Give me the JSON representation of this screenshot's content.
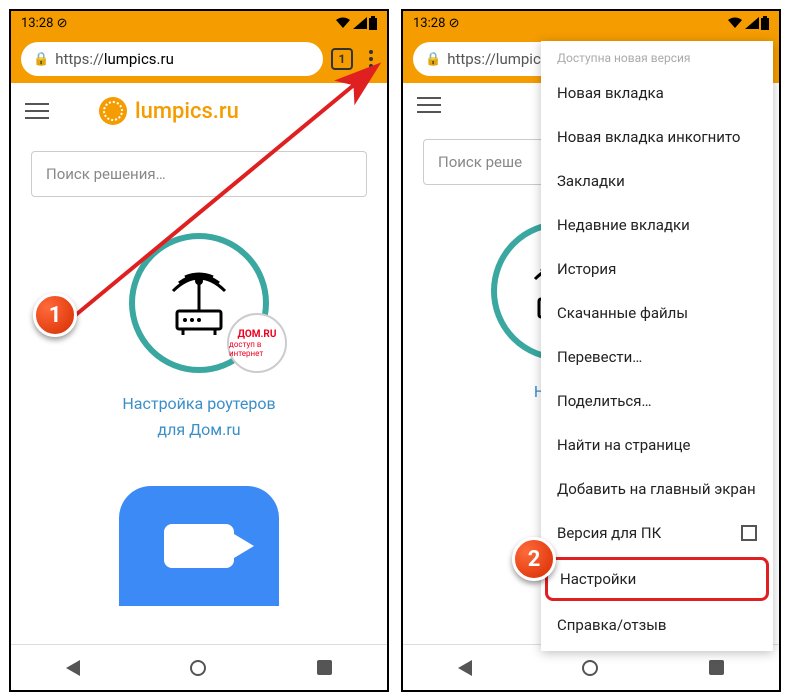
{
  "status": {
    "time": "13:28",
    "no_sim_icon": "⊘"
  },
  "url": {
    "prefix": "https://",
    "domain": "lumpics.ru"
  },
  "url_truncated": "https://lumpics.",
  "tabs": "1",
  "logo": "lumpics.ru",
  "search_placeholder": "Поиск решения…",
  "card": {
    "badge_main": "ДОМ.RU",
    "badge_sub": "доступ в интернет",
    "caption_line1": "Настройка роутеров",
    "caption_line2": "для Дом.ru"
  },
  "card_right_caption_trunc": "Настро",
  "menu": {
    "header": "Доступна новая версия",
    "items": [
      "Новая вкладка",
      "Новая вкладка инкогнито",
      "Закладки",
      "Недавние вкладки",
      "История",
      "Скачанные файлы",
      "Перевести…",
      "Поделиться…",
      "Найти на странице",
      "Добавить на главный экран"
    ],
    "desktop": "Версия для ПК",
    "settings": "Настройки",
    "help": "Справка/отзыв"
  },
  "steps": {
    "s1": "1",
    "s2": "2"
  }
}
